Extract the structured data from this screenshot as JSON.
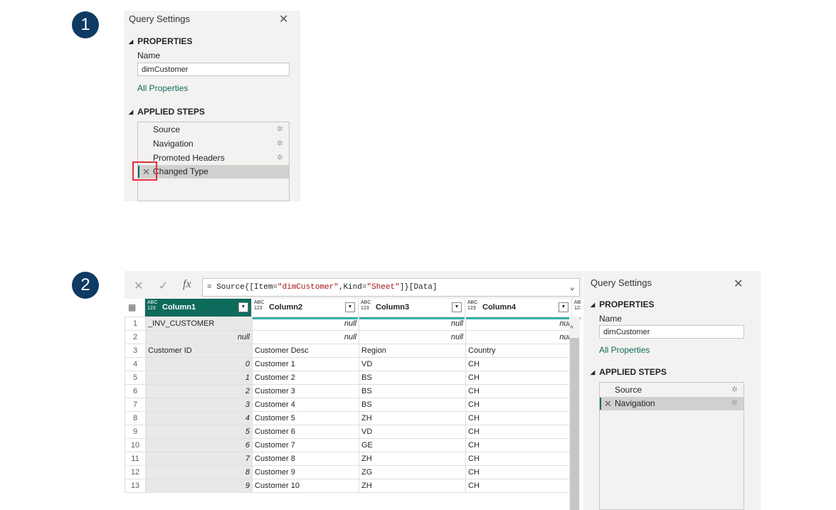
{
  "badges": [
    "1",
    "2"
  ],
  "panel1": {
    "title": "Query Settings",
    "properties_label": "PROPERTIES",
    "name_label": "Name",
    "name_value": "dimCustomer",
    "all_properties": "All Properties",
    "applied_steps_label": "APPLIED STEPS",
    "steps": [
      "Source",
      "Navigation",
      "Promoted Headers",
      "Changed Type"
    ]
  },
  "panel2": {
    "title": "Query Settings",
    "properties_label": "PROPERTIES",
    "name_label": "Name",
    "name_value": "dimCustomer",
    "all_properties": "All Properties",
    "applied_steps_label": "APPLIED STEPS",
    "steps": [
      "Source",
      "Navigation"
    ]
  },
  "formula": {
    "icons": [
      "close-icon",
      "check-icon",
      "fx-icon"
    ],
    "fx_label": "fx",
    "prefix": "= Source{[Item=",
    "item": "\"dimCustomer\"",
    "mid": ",Kind=",
    "kind": "\"Sheet\"",
    "suffix": "]}[Data]"
  },
  "grid": {
    "type_label": "ABC 123",
    "columns": [
      "Column1",
      "Column2",
      "Column3",
      "Column4"
    ],
    "rows": [
      [
        "1",
        "_INV_CUSTOMER",
        "null",
        "null",
        "nul"
      ],
      [
        "2",
        "null",
        "null",
        "null",
        "nul"
      ],
      [
        "3",
        "Customer ID",
        "Customer Desc",
        "Region",
        "Country"
      ],
      [
        "4",
        "0",
        "Customer 1",
        "VD",
        "CH"
      ],
      [
        "5",
        "1",
        "Customer 2",
        "BS",
        "CH"
      ],
      [
        "6",
        "2",
        "Customer 3",
        "BS",
        "CH"
      ],
      [
        "7",
        "3",
        "Customer 4",
        "BS",
        "CH"
      ],
      [
        "8",
        "4",
        "Customer 5",
        "ZH",
        "CH"
      ],
      [
        "9",
        "5",
        "Customer 6",
        "VD",
        "CH"
      ],
      [
        "10",
        "6",
        "Customer 7",
        "GE",
        "CH"
      ],
      [
        "11",
        "7",
        "Customer 8",
        "ZH",
        "CH"
      ],
      [
        "12",
        "8",
        "Customer 9",
        "ZG",
        "CH"
      ],
      [
        "13",
        "9",
        "Customer 10",
        "ZH",
        "CH"
      ]
    ]
  },
  "colors": {
    "accent": "#0e6b5c",
    "badge": "#0e3a63",
    "highlight": "#e0303a",
    "quality_bar": "#34b1a8"
  }
}
